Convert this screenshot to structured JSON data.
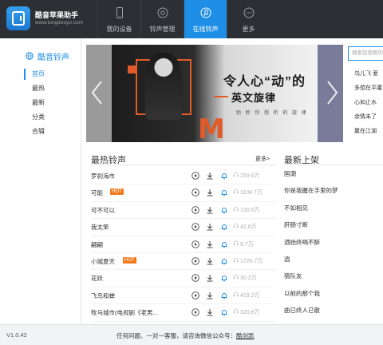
{
  "app": {
    "title": "酷音苹果助手",
    "url": "www.tongdooyo.com"
  },
  "nav": [
    {
      "label": "我的设备",
      "icon": "phone-icon",
      "active": false
    },
    {
      "label": "铃声管理",
      "icon": "bell-settings-icon",
      "active": false
    },
    {
      "label": "在线铃声",
      "icon": "music-note-icon",
      "active": true
    },
    {
      "label": "更多",
      "icon": "more-icon",
      "active": false
    }
  ],
  "sidebar": {
    "header": "酷音铃声",
    "items": [
      {
        "label": "首页",
        "active": true
      },
      {
        "label": "最热",
        "active": false
      },
      {
        "label": "最新",
        "active": false
      },
      {
        "label": "分类",
        "active": false
      },
      {
        "label": "合辑",
        "active": false
      }
    ]
  },
  "banner": {
    "title": "令人心“动”的",
    "subtitle": "英文旋律",
    "caption": "助 聆 你 想 听 的 旋 律",
    "letter": "M"
  },
  "search": {
    "placeholder": "搜索您想要的铃声"
  },
  "right_list": [
    "乌儿飞  爱",
    "多想在平庸",
    "心如止水",
    "余情未了",
    "赢在江湖"
  ],
  "hot": {
    "title": "最热铃声",
    "more": "更多>",
    "songs": [
      {
        "name": "罗刹海市",
        "hot": false,
        "count": "259.6万"
      },
      {
        "name": "可能",
        "hot": true,
        "count": "1104.7万"
      },
      {
        "name": "可不可以",
        "hot": false,
        "count": "130.6万"
      },
      {
        "name": "我太笨",
        "hot": false,
        "count": "42.8万"
      },
      {
        "name": "翩翩",
        "hot": false,
        "count": "9.7万"
      },
      {
        "name": "小城夏天",
        "hot": true,
        "count": "1726.7万"
      },
      {
        "name": "花妖",
        "hot": false,
        "count": "30.2万"
      },
      {
        "name": "飞鸟和蝉",
        "hot": false,
        "count": "419.2万"
      },
      {
        "name": "牧马城市(电视剧《老男...",
        "hot": false,
        "count": "320.6万"
      }
    ],
    "hot_badge": "HOT"
  },
  "new": {
    "title": "最新上架",
    "items": [
      "国潮",
      "你是我握在手里的梦",
      "不如相见",
      "肝肠寸断",
      "酒始终喝不醉",
      "逍",
      "猜队友",
      "以前的那个我",
      "曲已终人已散"
    ]
  },
  "footer": {
    "version": "V1.0.42",
    "text": "任何问题、一对一客服，请咨询微信公众号：",
    "link": "酷剑凯"
  },
  "colors": {
    "accent": "#1e8ee6",
    "header_bg": "#2c2f33",
    "hot_badge": "#f07a1e"
  }
}
